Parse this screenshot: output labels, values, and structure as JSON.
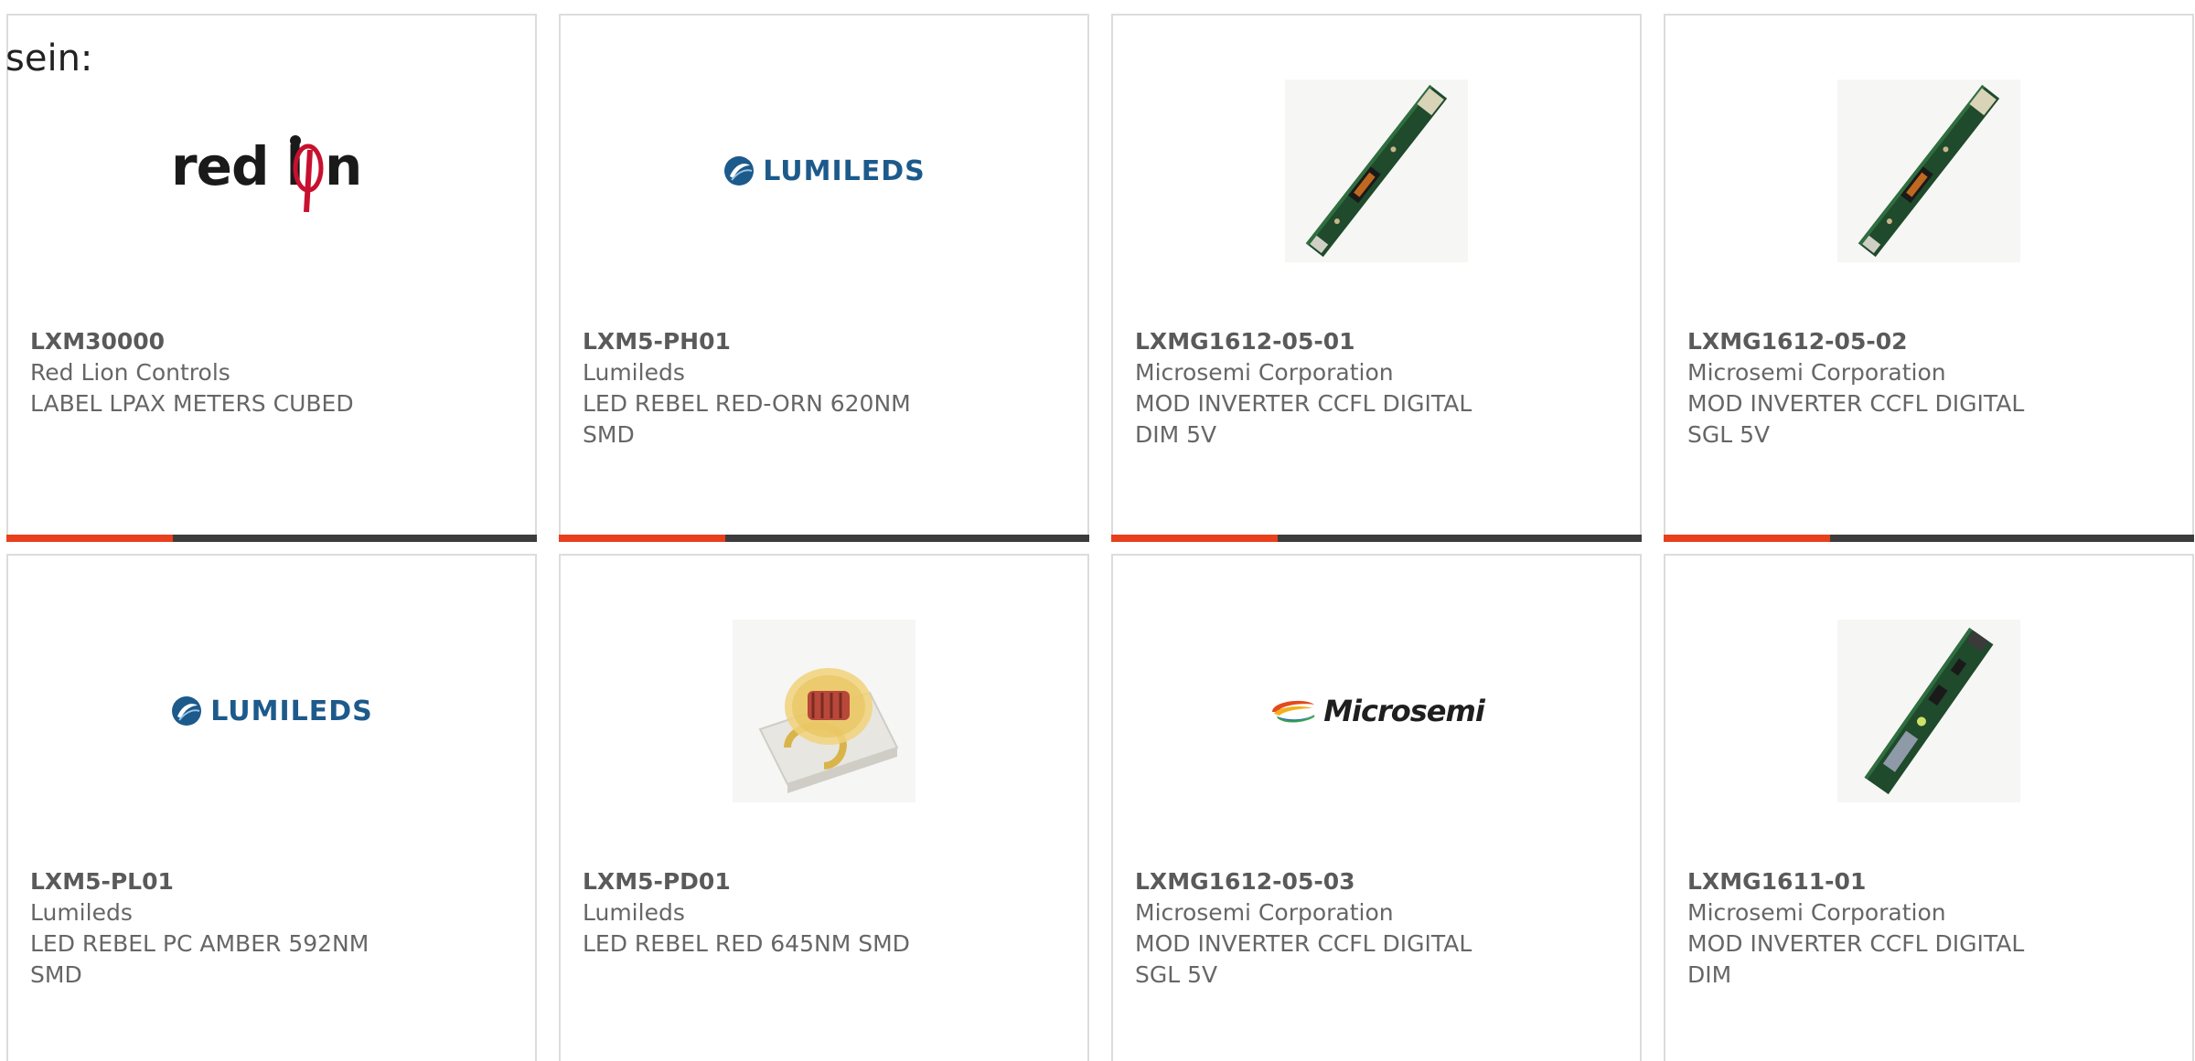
{
  "intro_text": "sein:",
  "colors": {
    "accent_bar": "#e8401c",
    "bar_base": "#3c3c3c",
    "lumileds_blue": "#1d5a8c",
    "redlion_red": "#c8102e"
  },
  "products": [
    {
      "part_number": "LXM30000",
      "manufacturer": "Red Lion Controls",
      "description": "LABEL LPAX METERS CUBED",
      "image": "red-lion-logo",
      "logo_text": "red lion"
    },
    {
      "part_number": "LXM5-PH01",
      "manufacturer": "Lumileds",
      "description": "LED REBEL RED-ORN 620NM SMD",
      "image": "lumileds-logo",
      "logo_text": "LUMILEDS"
    },
    {
      "part_number": "LXMG1612-05-01",
      "manufacturer": "Microsemi Corporation",
      "description": "MOD INVERTER CCFL DIGITAL DIM 5V",
      "image": "inverter-board-photo"
    },
    {
      "part_number": "LXMG1612-05-02",
      "manufacturer": "Microsemi Corporation",
      "description": "MOD INVERTER CCFL DIGITAL SGL 5V",
      "image": "inverter-board-photo"
    },
    {
      "part_number": "LXM5-PL01",
      "manufacturer": "Lumileds",
      "description": "LED REBEL PC AMBER 592NM SMD",
      "image": "lumileds-logo",
      "logo_text": "LUMILEDS"
    },
    {
      "part_number": "LXM5-PD01",
      "manufacturer": "Lumileds",
      "description": "LED REBEL RED 645NM SMD",
      "image": "led-rebel-photo"
    },
    {
      "part_number": "LXMG1612-05-03",
      "manufacturer": "Microsemi Corporation",
      "description": "MOD INVERTER CCFL DIGITAL SGL 5V",
      "image": "microsemi-logo",
      "logo_text": "Microsemi"
    },
    {
      "part_number": "LXMG1611-01",
      "manufacturer": "Microsemi Corporation",
      "description": "MOD INVERTER CCFL DIGITAL DIM",
      "image": "inverter-board-photo-2"
    }
  ]
}
